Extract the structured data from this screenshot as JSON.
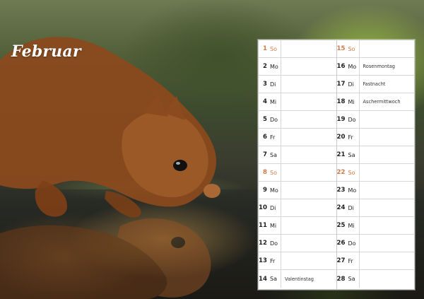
{
  "month": "Februar",
  "calendar": {
    "left_column": [
      {
        "day": "1",
        "weekday": "So",
        "note": "",
        "sunday": true
      },
      {
        "day": "2",
        "weekday": "Mo",
        "note": "",
        "sunday": false
      },
      {
        "day": "3",
        "weekday": "Di",
        "note": "",
        "sunday": false
      },
      {
        "day": "4",
        "weekday": "Mi",
        "note": "",
        "sunday": false
      },
      {
        "day": "5",
        "weekday": "Do",
        "note": "",
        "sunday": false
      },
      {
        "day": "6",
        "weekday": "Fr",
        "note": "",
        "sunday": false
      },
      {
        "day": "7",
        "weekday": "Sa",
        "note": "",
        "sunday": false
      },
      {
        "day": "8",
        "weekday": "So",
        "note": "",
        "sunday": true
      },
      {
        "day": "9",
        "weekday": "Mo",
        "note": "",
        "sunday": false
      },
      {
        "day": "10",
        "weekday": "Di",
        "note": "",
        "sunday": false
      },
      {
        "day": "11",
        "weekday": "Mi",
        "note": "",
        "sunday": false
      },
      {
        "day": "12",
        "weekday": "Do",
        "note": "",
        "sunday": false
      },
      {
        "day": "13",
        "weekday": "Fr",
        "note": "",
        "sunday": false
      },
      {
        "day": "14",
        "weekday": "Sa",
        "note": "Valentinstag",
        "sunday": false
      }
    ],
    "right_column": [
      {
        "day": "15",
        "weekday": "So",
        "note": "",
        "sunday": true
      },
      {
        "day": "16",
        "weekday": "Mo",
        "note": "Rosenmontag",
        "sunday": false
      },
      {
        "day": "17",
        "weekday": "Di",
        "note": "Fastnacht",
        "sunday": false
      },
      {
        "day": "18",
        "weekday": "Mi",
        "note": "Aschermittwoch",
        "sunday": false
      },
      {
        "day": "19",
        "weekday": "Do",
        "note": "",
        "sunday": false
      },
      {
        "day": "20",
        "weekday": "Fr",
        "note": "",
        "sunday": false
      },
      {
        "day": "21",
        "weekday": "Sa",
        "note": "",
        "sunday": false
      },
      {
        "day": "22",
        "weekday": "So",
        "note": "",
        "sunday": true
      },
      {
        "day": "23",
        "weekday": "Mo",
        "note": "",
        "sunday": false
      },
      {
        "day": "24",
        "weekday": "Di",
        "note": "",
        "sunday": false
      },
      {
        "day": "25",
        "weekday": "Mi",
        "note": "",
        "sunday": false
      },
      {
        "day": "26",
        "weekday": "Do",
        "note": "",
        "sunday": false
      },
      {
        "day": "27",
        "weekday": "Fr",
        "note": "",
        "sunday": false
      },
      {
        "day": "28",
        "weekday": "Sa",
        "note": "",
        "sunday": false
      }
    ]
  },
  "colors": {
    "sunday": "#d07a45",
    "grid": "#d6d6d6",
    "panel_border": "#c9c9c9"
  }
}
